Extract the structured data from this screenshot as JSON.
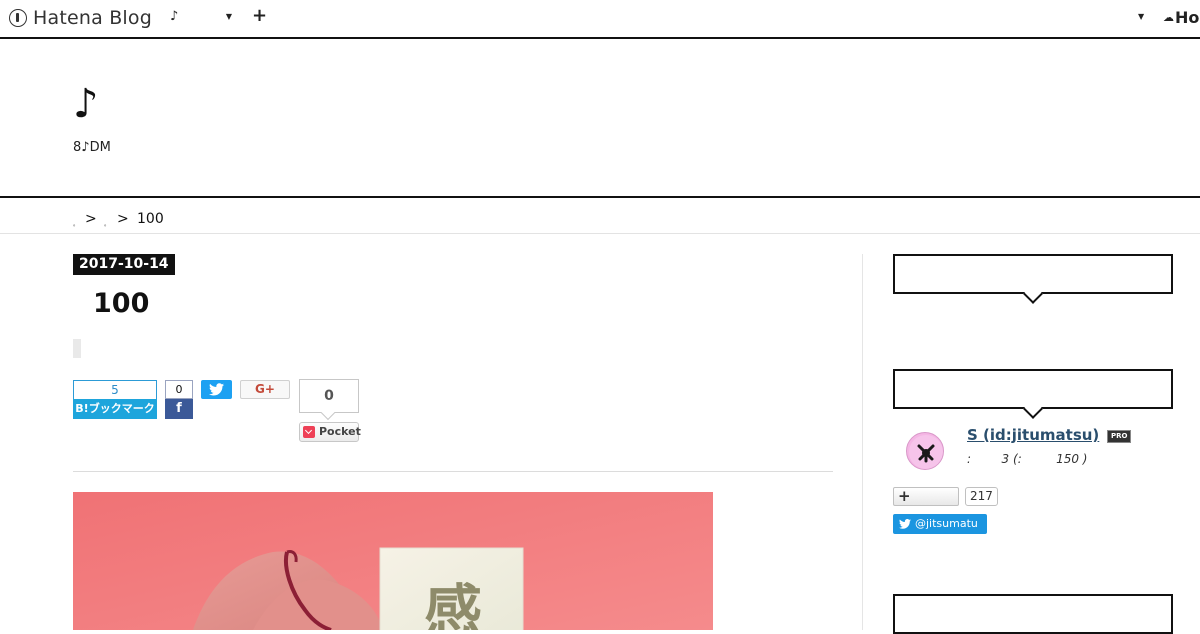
{
  "topbar": {
    "logo_text": "Hatena Blog",
    "blog_selector": "♪",
    "add_button": "+",
    "right_logo": "Ho"
  },
  "blog": {
    "title": "♪",
    "description": "8♪DM"
  },
  "breadcrumb": {
    "items": [
      "。",
      "。"
    ],
    "separator": ">",
    "current": "100"
  },
  "entry": {
    "date": "2017-10-14",
    "title": "100",
    "share": {
      "hatena_count": "5",
      "hatena_label": "B!ブックマーク",
      "facebook_count": "0",
      "facebook_icon": "f",
      "google_plus": "G+",
      "pocket_count": "0",
      "pocket_label": "Pocket"
    },
    "image_text": "感"
  },
  "sidebar": {
    "author": {
      "name": "S (id:jitumatsu)",
      "pro_badge": "PRO",
      "meta": ":        3 (:         150 )"
    },
    "follow": {
      "button": "+",
      "count": "217"
    },
    "twitter": {
      "handle": "@jitsumatu"
    }
  },
  "colors": {
    "accent_dark": "#111111",
    "hatena_blue": "#1ea5dc",
    "facebook": "#3b5998",
    "twitter": "#1da1f2",
    "pocket": "#ee4056",
    "image_bg": "#f27a7d"
  }
}
